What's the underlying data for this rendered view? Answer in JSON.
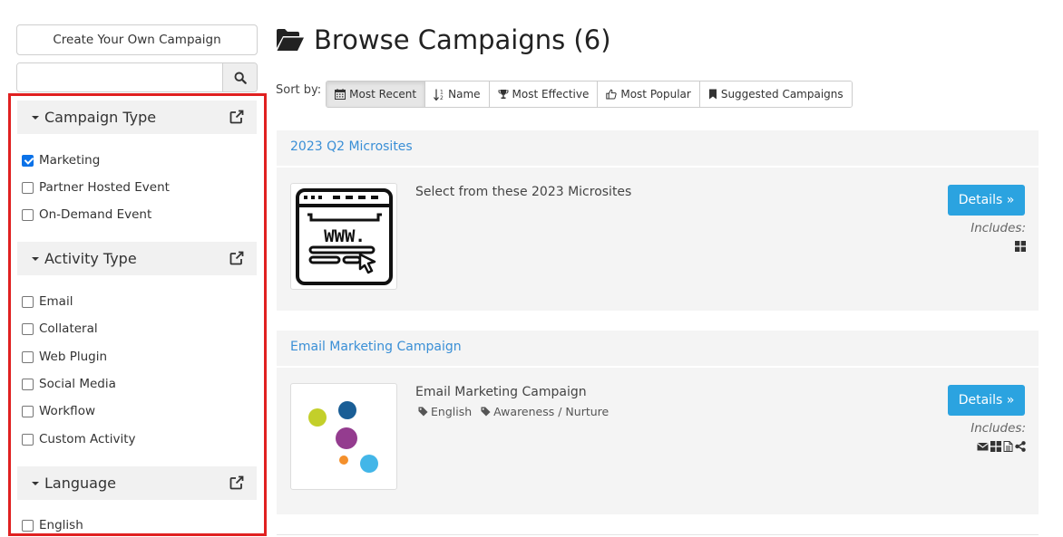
{
  "sidebar": {
    "create_button_label": "Create Your Own Campaign",
    "search_placeholder": "",
    "filters": {
      "campaign_type": {
        "title": "Campaign Type",
        "options": [
          {
            "label": "Marketing",
            "checked": true
          },
          {
            "label": "Partner Hosted Event",
            "checked": false
          },
          {
            "label": "On-Demand Event",
            "checked": false
          }
        ]
      },
      "activity_type": {
        "title": "Activity Type",
        "options": [
          {
            "label": "Email",
            "checked": false
          },
          {
            "label": "Collateral",
            "checked": false
          },
          {
            "label": "Web Plugin",
            "checked": false
          },
          {
            "label": "Social Media",
            "checked": false
          },
          {
            "label": "Workflow",
            "checked": false
          },
          {
            "label": "Custom Activity",
            "checked": false
          }
        ]
      },
      "language": {
        "title": "Language",
        "options": [
          {
            "label": "English",
            "checked": false
          }
        ]
      }
    },
    "highlight_color": "#e02020"
  },
  "main": {
    "title": "Browse Campaigns (6)",
    "sort_label": "Sort by:",
    "sort_options": [
      {
        "label": "Most Recent",
        "icon": "calendar-icon",
        "active": true
      },
      {
        "label": "Name",
        "icon": "sort-alpha-icon",
        "active": false
      },
      {
        "label": "Most Effective",
        "icon": "trophy-icon",
        "active": false
      },
      {
        "label": "Most Popular",
        "icon": "thumbs-up-icon",
        "active": false
      },
      {
        "label": "Suggested Campaigns",
        "icon": "bookmark-icon",
        "active": false
      }
    ],
    "campaigns": [
      {
        "title": "2023 Q2 Microsites",
        "description": "Select from these 2023 Microsites",
        "tags": [],
        "details_label": "Details »",
        "includes_label": "Includes:",
        "includes_icons": [
          "grid-icon"
        ]
      },
      {
        "title": "Email Marketing Campaign",
        "description": "Email Marketing Campaign",
        "tags": [
          "English",
          "Awareness / Nurture"
        ],
        "details_label": "Details »",
        "includes_label": "Includes:",
        "includes_icons": [
          "envelope-icon",
          "grid-icon",
          "document-icon",
          "share-icon"
        ]
      }
    ],
    "accent_color": "#2ba3e0",
    "link_color": "#3a8fd6"
  }
}
